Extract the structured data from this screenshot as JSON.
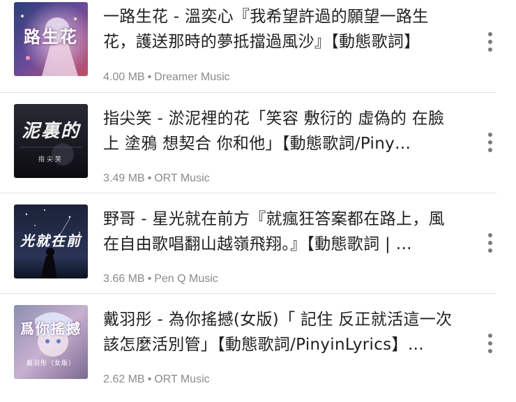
{
  "items": [
    {
      "title": "一路生花 - 溫奕心『我希望許過的願望一路生花，護送那時的夢抵擋過風沙』【動態歌詞】",
      "size": "4.00 MB",
      "separator": "•",
      "channel": "Dreamer Music",
      "thumb_text": "路生花",
      "thumb_icon": "album-art-icon"
    },
    {
      "title": "指尖笑 - 淤泥裡的花「笑容 敷衍的 虛偽的 在臉上 塗鴉 想契合 你和他」【動態歌詞/Piny…",
      "size": "3.49 MB",
      "separator": "•",
      "channel": "ORT Music",
      "thumb_text": "泥裏的",
      "thumb_subtext": "指尖笑",
      "thumb_icon": "album-art-icon"
    },
    {
      "title": "野哥 - 星光就在前方『就瘋狂答案都在路上，風在自由歌唱翻山越嶺飛翔。』【動態歌詞 | …",
      "size": "3.66 MB",
      "separator": "•",
      "channel": "Pen Q Music",
      "thumb_text": "光就在前",
      "thumb_icon": "album-art-icon"
    },
    {
      "title": "戴羽彤 - 為你搖撼(女版)「 記住 反正就活這一次 該怎麼活別管」【動態歌詞/PinyinLyrics】…",
      "size": "2.62 MB",
      "separator": "•",
      "channel": "ORT Music",
      "thumb_text": "爲你搖撼",
      "thumb_subtext": "戴羽彤（女版）",
      "thumb_icon": "album-art-icon"
    }
  ],
  "colors": {
    "title": "#202020",
    "meta": "#8a8a8a",
    "divider": "#e2e2e2",
    "more_icon": "#7a7a7a"
  }
}
